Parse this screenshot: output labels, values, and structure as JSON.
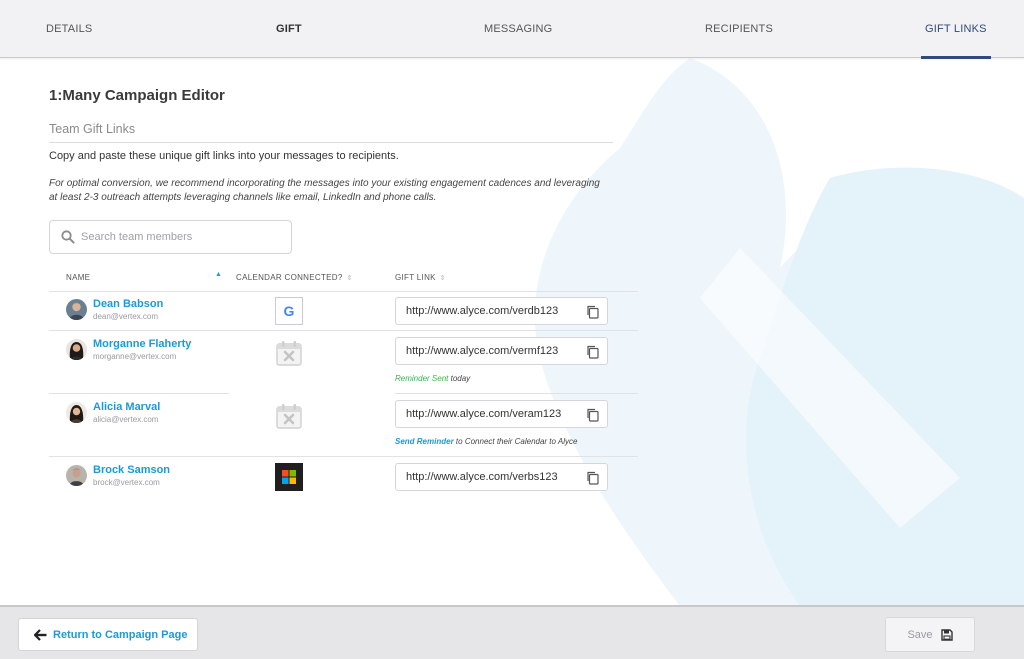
{
  "tabs": [
    {
      "label": "DETAILS"
    },
    {
      "label": "GIFT"
    },
    {
      "label": "MESSAGING"
    },
    {
      "label": "RECIPIENTS"
    },
    {
      "label": "GIFT LINKS"
    }
  ],
  "page": {
    "title": "1:Many Campaign Editor",
    "section_title": "Team Gift Links",
    "intro": "Copy and paste these unique gift links into your messages to recipients.",
    "note": "For optimal conversion, we recommend incorporating the messages into your existing engagement cadences and leveraging at least 2-3 outreach attempts leveraging channels like email, LinkedIn and phone calls."
  },
  "search": {
    "placeholder": "Search team members",
    "icon": "search-icon"
  },
  "table": {
    "headers": {
      "name": "NAME",
      "calendar": "CALENDAR CONNECTED?",
      "link": "GIFT LINK"
    },
    "rows": [
      {
        "name": "Dean Babson",
        "email": "dean@vertex.com",
        "calendar": "google-calendar-icon",
        "link": "http://www.alyce.com/verdb123",
        "status": null
      },
      {
        "name": "Morganne Flaherty",
        "email": "morganne@vertex.com",
        "calendar": "calendar-not-connected-icon",
        "link": "http://www.alyce.com/vermf123",
        "status": {
          "highlight": "Reminder Sent",
          "rest": "today"
        }
      },
      {
        "name": "Alicia Marval",
        "email": "alicia@vertex.com",
        "calendar": "calendar-not-connected-icon",
        "link": "http://www.alyce.com/veram123",
        "status": {
          "highlight": "Send Reminder",
          "rest": "to Connect their Calendar to Alyce"
        }
      },
      {
        "name": "Brock Samson",
        "email": "brock@vertex.com",
        "calendar": "microsoft-calendar-icon",
        "link": "http://www.alyce.com/verbs123",
        "status": null
      }
    ]
  },
  "footer": {
    "return_label": "Return to Campaign Page",
    "save_label": "Save"
  },
  "colors": {
    "accent": "#1b9ad6",
    "tab_active": "#2f4a7c",
    "reminder_sent": "#3bb24a"
  }
}
